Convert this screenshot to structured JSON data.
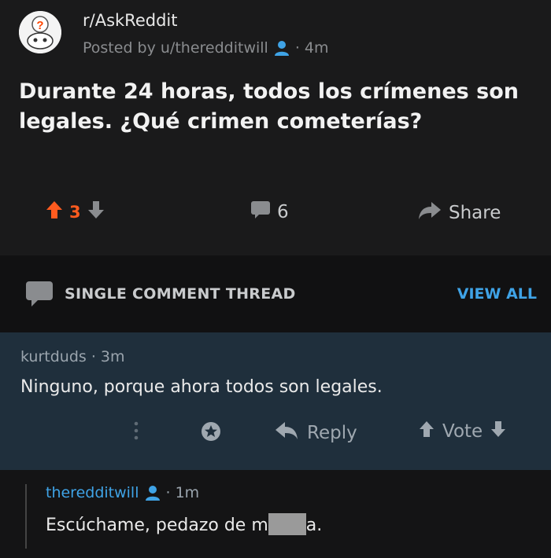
{
  "post": {
    "subreddit": "r/AskReddit",
    "posted_by": "Posted by u/theredditwill",
    "time": "· 4m",
    "title": "Durante 24 horas, todos los crímenes son legales. ¿Qué crimen cometerías?",
    "score": "3",
    "comments": "6",
    "share_label": "Share"
  },
  "thread": {
    "title": "SINGLE COMMENT THREAD",
    "view_all": "VIEW ALL"
  },
  "comment": {
    "author_time": "kurtduds · 3m",
    "body": "Ninguno, porque ahora todos son legales.",
    "reply_label": "Reply",
    "vote_label": "Vote"
  },
  "reply": {
    "author": "theredditwill",
    "time": "· 1m",
    "body_start": "Escúchame, pedazo de m",
    "body_end": "a."
  },
  "colors": {
    "upvote": "#ff5b1f",
    "link_blue": "#3fa3e6",
    "comment_bg": "#1f2f3c"
  },
  "icons": [
    "avatar-icon",
    "user-icon",
    "upvote-icon",
    "downvote-icon",
    "comment-icon",
    "share-icon",
    "thread-icon",
    "more-icon",
    "award-icon",
    "reply-icon"
  ]
}
